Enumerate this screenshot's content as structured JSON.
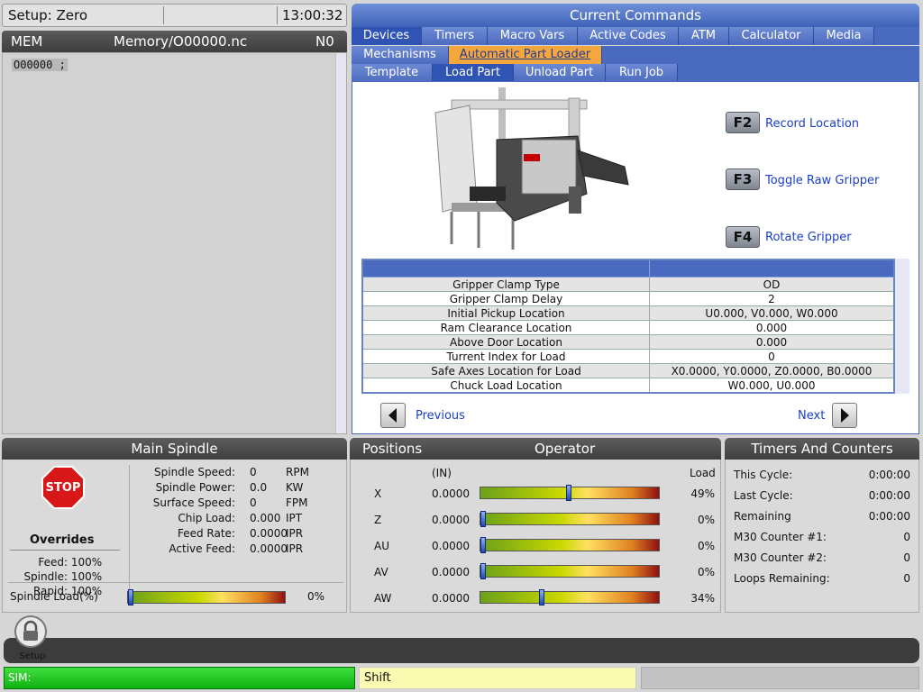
{
  "topbar": {
    "mode": "Setup: Zero",
    "clock": "13:00:32"
  },
  "program": {
    "mode": "MEM",
    "path": "Memory/O00000.nc",
    "line": "N0",
    "code": "O00000 ;"
  },
  "commands": {
    "title": "Current Commands",
    "tabs1": [
      "Devices",
      "Timers",
      "Macro Vars",
      "Active Codes",
      "ATM",
      "Calculator",
      "Media"
    ],
    "tabs2": [
      "Mechanisms",
      "Automatic Part Loader"
    ],
    "tabs3": [
      "Template",
      "Load Part",
      "Unload Part",
      "Run Job"
    ],
    "fkeys": [
      {
        "key": "F2",
        "label": "Record Location"
      },
      {
        "key": "F3",
        "label": "Toggle Raw Gripper"
      },
      {
        "key": "F4",
        "label": "Rotate Gripper"
      }
    ],
    "table": [
      {
        "name": "Gripper Clamp Type",
        "value": "OD"
      },
      {
        "name": "Gripper Clamp Delay",
        "value": "2"
      },
      {
        "name": "Initial Pickup Location",
        "value": "U0.000, V0.000, W0.000"
      },
      {
        "name": "Ram Clearance Location",
        "value": "0.000"
      },
      {
        "name": "Above Door Location",
        "value": "0.000"
      },
      {
        "name": "Turrent Index for Load",
        "value": "0"
      },
      {
        "name": "Safe Axes Location for Load",
        "value": "X0.0000, Y0.0000, Z0.0000, B0.0000"
      },
      {
        "name": "Chuck Load Location",
        "value": "W0.000, U0.000"
      }
    ],
    "prev_label": "Previous",
    "next_label": "Next"
  },
  "spindle": {
    "title": "Main Spindle",
    "stop_label": "STOP",
    "overrides_label": "Overrides",
    "overrides": [
      {
        "label": "Feed:",
        "value": "100%"
      },
      {
        "label": "Spindle:",
        "value": "100%"
      },
      {
        "label": "Rapid:",
        "value": "100%"
      }
    ],
    "readings": [
      {
        "label": "Spindle Speed:",
        "value": "0",
        "unit": "RPM"
      },
      {
        "label": "Spindle Power:",
        "value": "0.0",
        "unit": "KW"
      },
      {
        "label": "Surface Speed:",
        "value": "0",
        "unit": "FPM"
      },
      {
        "label": "Chip Load:",
        "value": "0.000",
        "unit": "IPT"
      },
      {
        "label": "Feed Rate:",
        "value": "0.0000",
        "unit": "IPR"
      },
      {
        "label": "Active Feed:",
        "value": "0.0000",
        "unit": "IPR"
      }
    ],
    "load_label": "Spindle Load(%)",
    "load_value": "0%",
    "load_fraction": 0
  },
  "positions": {
    "title_left": "Positions",
    "title_right": "Operator",
    "unit": "(IN)",
    "load_header": "Load",
    "axes": [
      {
        "axis": "X",
        "value": "0.0000",
        "load": "49%",
        "fraction": 0.49
      },
      {
        "axis": "Z",
        "value": "0.0000",
        "load": "0%",
        "fraction": 0
      },
      {
        "axis": "AU",
        "value": "0.0000",
        "load": "0%",
        "fraction": 0
      },
      {
        "axis": "AV",
        "value": "0.0000",
        "load": "0%",
        "fraction": 0
      },
      {
        "axis": "AW",
        "value": "0.0000",
        "load": "34%",
        "fraction": 0.34
      }
    ]
  },
  "timers": {
    "title": "Timers And Counters",
    "rows": [
      {
        "label": "This Cycle:",
        "value": "0:00:00"
      },
      {
        "label": "Last Cycle:",
        "value": "0:00:00"
      },
      {
        "label": "Remaining",
        "value": "0:00:00"
      },
      {
        "label": "M30 Counter #1:",
        "value": "0"
      },
      {
        "label": "M30 Counter #2:",
        "value": "0"
      },
      {
        "label": "Loops Remaining:",
        "value": "0"
      }
    ]
  },
  "footer": {
    "setup_label": "Setup",
    "sim_label": "SIM:",
    "shift_label": "Shift"
  }
}
